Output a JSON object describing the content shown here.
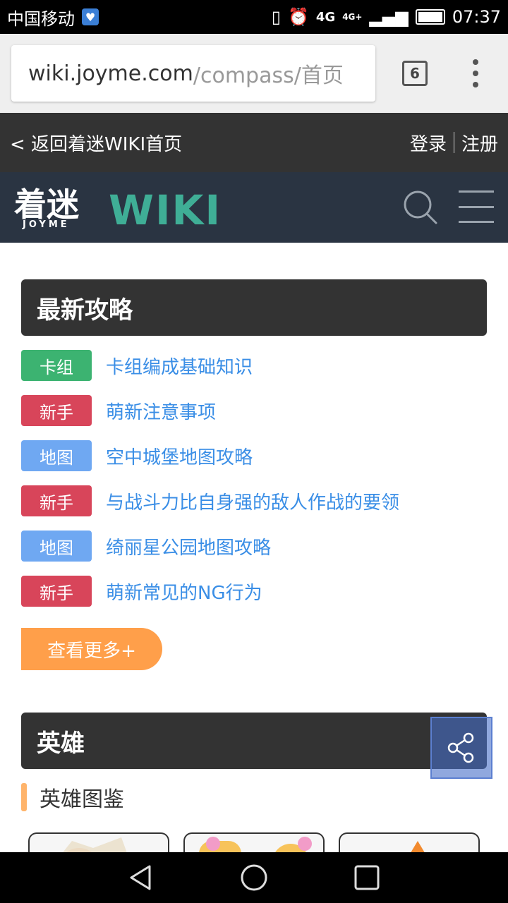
{
  "status_bar": {
    "carrier": "中国移动",
    "network": "4G",
    "network2": "4G+",
    "time": "07:37"
  },
  "browser": {
    "url_host": "wiki.joyme.com",
    "url_path": "/compass/首页",
    "tab_count": "6"
  },
  "top_nav": {
    "back_label": "< 返回着迷WIKI首页",
    "login_label": "登录",
    "register_label": "注册"
  },
  "header": {
    "logo_cn": "着迷",
    "logo_sub": "JOYME",
    "logo_wiki": "WIKI"
  },
  "latest_guides": {
    "title": "最新攻略",
    "items": [
      {
        "tag": "卡组",
        "tag_color": "#3cb371",
        "title": "卡组编成基础知识"
      },
      {
        "tag": "新手",
        "tag_color": "#d8455a",
        "title": "萌新注意事项"
      },
      {
        "tag": "地图",
        "tag_color": "#6fa8f2",
        "title": "空中城堡地图攻略"
      },
      {
        "tag": "新手",
        "tag_color": "#d8455a",
        "title": "与战斗力比自身强的敌人作战的要领"
      },
      {
        "tag": "地图",
        "tag_color": "#6fa8f2",
        "title": "绮丽星公园地图攻略"
      },
      {
        "tag": "新手",
        "tag_color": "#d8455a",
        "title": "萌新常见的NG行为"
      }
    ],
    "more_label": "查看更多+"
  },
  "heroes": {
    "title": "英雄",
    "sub_title": "英雄图鉴"
  },
  "colors": {
    "accent_link": "#3a8ee6",
    "more_button": "#ff9f4a",
    "header_bg": "#2a3442",
    "logo_teal": "#3fae96"
  }
}
